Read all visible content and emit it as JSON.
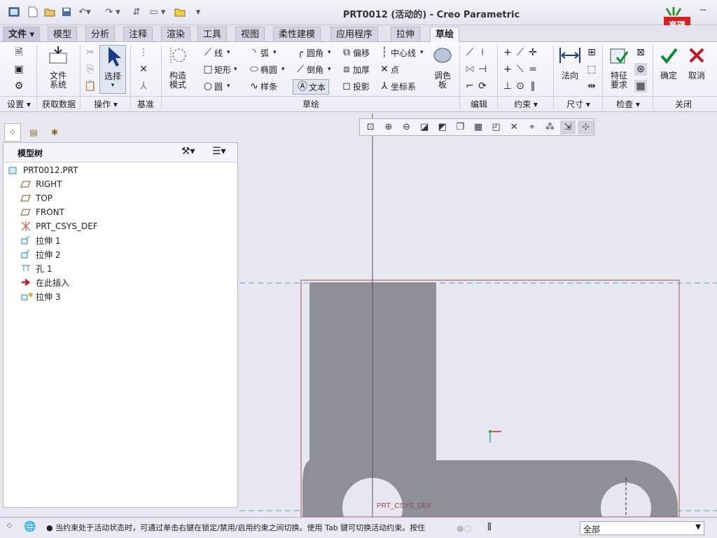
{
  "window": {
    "title": "PRT0012 (活动的) - Creo Parametric",
    "min": "─",
    "max": "□",
    "close": "✕"
  },
  "quick_access": [
    "new-icon",
    "open-icon",
    "save-icon",
    "undo-icon",
    "redo-icon",
    "regenerate-icon",
    "windows-icon",
    "close-window-icon",
    "customize-icon"
  ],
  "logo_text": "育碟软件",
  "tabs": [
    "文件 ▾",
    "模型",
    "分析",
    "注释",
    "渲染",
    "工具",
    "视图",
    "柔性建模",
    "应用程序",
    "拉伸",
    "草绘"
  ],
  "active_tab": "草绘",
  "ribbon": {
    "file_system": "文件\n系统",
    "select": "选择",
    "construction_mode": "构造\n模式",
    "sketch_tools": {
      "line": "线",
      "arc": "弧",
      "fillet": "圆角",
      "offset": "偏移",
      "centerline": "中心线",
      "rectangle": "矩形",
      "ellipse": "椭圆",
      "chamfer": "倒角",
      "thicken": "加厚",
      "point": "点",
      "circle": "圆",
      "spline": "样条",
      "text": "文本",
      "project": "投影",
      "csys": "坐标系"
    },
    "palette": "调色\n板",
    "normal": "法向",
    "feature_requirements": "特征\n要求",
    "ok": "确定",
    "cancel": "取消",
    "groups": {
      "setup": "设置 ▾",
      "get_data": "获取数据",
      "operations": "操作 ▾",
      "datum": "基准",
      "sketch": "草绘",
      "edit": "编辑",
      "constrain": "约束 ▾",
      "dimension": "尺寸 ▾",
      "inspect": "检查 ▾",
      "close": "关闭"
    }
  },
  "model_tree": {
    "header": "模型树",
    "items": [
      {
        "label": "PRT0012.PRT",
        "icon": "part-icon"
      },
      {
        "label": "RIGHT",
        "icon": "datum-plane-icon"
      },
      {
        "label": "TOP",
        "icon": "datum-plane-icon"
      },
      {
        "label": "FRONT",
        "icon": "datum-plane-icon"
      },
      {
        "label": "PRT_CSYS_DEF",
        "icon": "csys-icon"
      },
      {
        "label": "拉伸 1",
        "icon": "extrude-icon"
      },
      {
        "label": "拉伸 2",
        "icon": "extrude-icon"
      },
      {
        "label": "孔 1",
        "icon": "hole-icon"
      },
      {
        "label": "在此插入",
        "icon": "insert-arrow-icon"
      },
      {
        "label": "拉伸 3",
        "icon": "extrude-new-icon"
      }
    ]
  },
  "graphics": {
    "csys_label": "PRT_CSYS_DEF"
  },
  "status": {
    "message": "● 当约束处于活动状态时，可通过单击右键在锁定/禁用/启用约束之间切换。使用 Tab 键可切换活动约束。按住",
    "filter_value": "全部"
  },
  "colors": {
    "accent": "#0a8f2e",
    "cancel": "#c8141e",
    "sketch_grey": "#8d9096",
    "ref_line": "#3fb3b3"
  }
}
